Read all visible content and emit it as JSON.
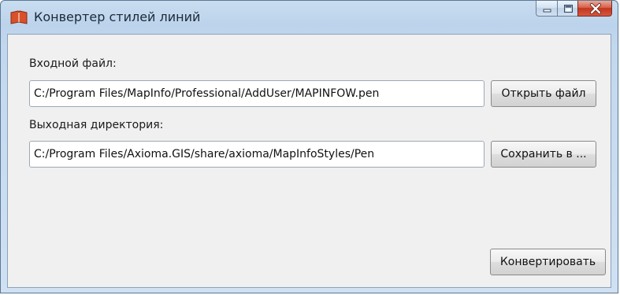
{
  "window": {
    "title": "Конвертер стилей линий",
    "icon": "book-icon",
    "controls": [
      "minimize-icon",
      "maximize-icon",
      "close-icon"
    ]
  },
  "form": {
    "input_label": "Входной файл:",
    "input_value": "C:/Program Files/MapInfo/Professional/AddUser/MAPINFOW.pen",
    "open_button": "Открыть файл",
    "output_label": "Выходная директория:",
    "output_value": "C:/Program Files/Axioma.GIS/share/axioma/MapInfoStyles/Pen",
    "save_button": "Сохранить в ...",
    "convert_button": "Конвертировать"
  },
  "colors": {
    "titlebar": "#c2d8ee",
    "close_button": "#c94a33",
    "client_background": "#f0f0f0"
  }
}
